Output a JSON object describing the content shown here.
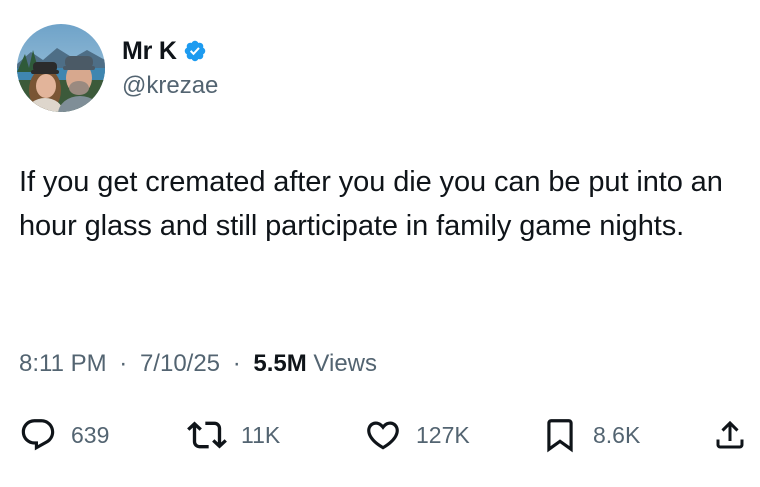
{
  "user": {
    "display_name": "Mr K",
    "handle": "@krezae",
    "verified": true,
    "verified_color": "#1d9bf0"
  },
  "tweet": {
    "text": "If you get cremated after you die you can be put into an hour glass and still participate in family game nights.",
    "time": "8:11 PM",
    "separator": "·",
    "date": "7/10/25",
    "views_count": "5.5M",
    "views_label": "Views"
  },
  "actions": {
    "reply": {
      "icon": "reply-icon",
      "count": "639"
    },
    "retweet": {
      "icon": "retweet-icon",
      "count": "11K"
    },
    "like": {
      "icon": "heart-icon",
      "count": "127K"
    },
    "bookmark": {
      "icon": "bookmark-icon",
      "count": "8.6K"
    },
    "share": {
      "icon": "share-icon"
    }
  },
  "colors": {
    "text_primary": "#0f1419",
    "text_secondary": "#536471"
  }
}
